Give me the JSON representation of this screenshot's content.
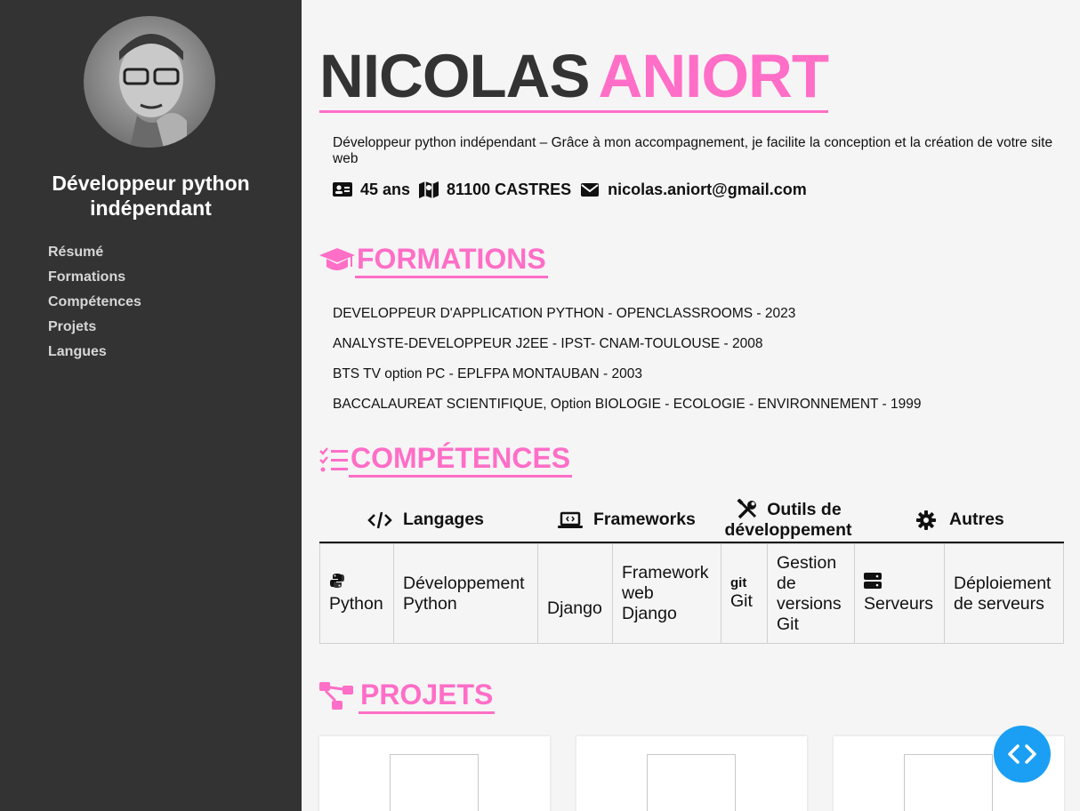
{
  "sidebar": {
    "title": "Développeur python indépendant",
    "nav": [
      "Résumé",
      "Formations",
      "Compétences",
      "Projets",
      "Langues"
    ]
  },
  "header": {
    "first_name": "NICOLAS",
    "last_name": "ANIORT",
    "intro": "Développeur python indépendant – Grâce à mon accompagnement, je facilite la conception et la création de votre site web",
    "age": "45 ans",
    "location": "81100 CASTRES",
    "email": "nicolas.aniort@gmail.com"
  },
  "formations": {
    "title": "FORMATIONS",
    "items": [
      "DEVELOPPEUR D'APPLICATION PYTHON - OPENCLASSROOMS - 2023",
      "ANALYSTE-DEVELOPPEUR J2EE - IPST- CNAM-TOULOUSE - 2008",
      "BTS TV option PC - EPLFPA MONTAUBAN - 2003",
      "BACCALAUREAT SCIENTIFIQUE, Option BIOLOGIE - ECOLOGIE - ENVIRONNEMENT - 1999"
    ]
  },
  "competences": {
    "title": "COMPÉTENCES",
    "headers": {
      "langages": "Langages",
      "frameworks": "Frameworks",
      "outils_line1": "Outils de",
      "outils_line2": "développement",
      "autres": "Autres"
    },
    "cells": {
      "python": "Python",
      "python_desc": "Développement Python",
      "django": "Django",
      "django_desc_1": "Framework",
      "django_desc_2": "web",
      "django_desc_3": "Django",
      "git_logo": "git",
      "git": "Git",
      "git_desc_1": "Gestion",
      "git_desc_2": "de",
      "git_desc_3": "versions",
      "git_desc_4": "Git",
      "serveurs": "Serveurs",
      "serveurs_desc_1": "Déploiement",
      "serveurs_desc_2": "de serveurs"
    }
  },
  "projets": {
    "title": "PROJETS"
  },
  "colors": {
    "accent": "#ff6ec7",
    "sidebar_bg": "#333333",
    "fab": "#1a9ff4"
  }
}
